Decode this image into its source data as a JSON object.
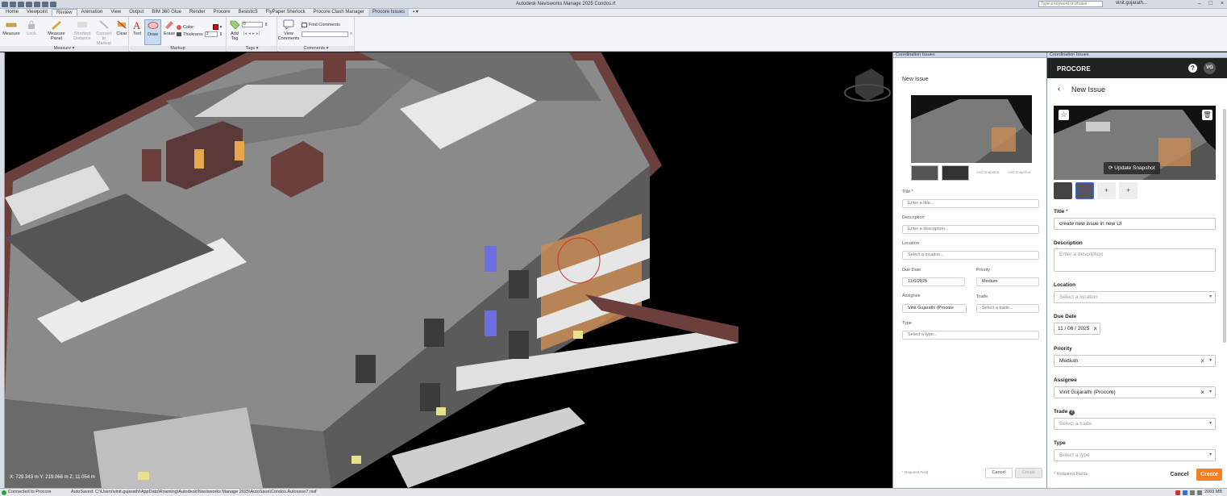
{
  "window": {
    "title": "Autodesk Navisworks Manage 2025    Condos.rt",
    "search_placeholder": "Type a keyword or phrase",
    "user": "vinit.gujarath..."
  },
  "tabs": [
    "Home",
    "Viewpoint",
    "Review",
    "Animation",
    "View",
    "Output",
    "BIM 360 Glue",
    "Render",
    "Procore",
    "Besistic5",
    "FlyPaper Sherlock",
    "Procore Clash Manager",
    "Procore Issues"
  ],
  "active_tab": "Review",
  "ribbon": {
    "measure_group": "Measure",
    "markup_group": "Markup",
    "tags_group": "Tags",
    "comments_group": "Comments",
    "buttons": {
      "measure": "Measure",
      "lock": "Lock",
      "measure_panel": "Measure Panel",
      "shortest_distance": "Shortest Distance",
      "convert_to_markup": "Convert to Markup",
      "clear": "Clear",
      "text": "Text",
      "draw": "Draw",
      "erase": "Erase",
      "color": "Color:",
      "thickness": "Thickness",
      "thickness_value": "3",
      "add_tag": "Add Tag",
      "tag_value": "0",
      "view_comments": "View Comments",
      "find_comments": "Find Comments"
    }
  },
  "viewport": {
    "coords": "X: 729.343 m  Y: 219.068 m  Z: 11.054 m"
  },
  "coordination": {
    "header": "Coordination Issues",
    "title": "New Issue",
    "add_snapshot": "Add Snapshot",
    "title_label": "Title *",
    "title_placeholder": "Enter a title...",
    "description_label": "Description",
    "description_placeholder": "Enter a description...",
    "location_label": "Location",
    "location_placeholder": "Select a location...",
    "due_date_label": "Due Date",
    "due_date_value": "11/6/2025",
    "priority_label": "Priority",
    "priority_value": "Medium",
    "assignee_label": "Assignee",
    "assignee_value": "Vinit Gujarathi (Procore",
    "trade_label": "Trade",
    "trade_placeholder": "Select a trade...",
    "type_label": "Type",
    "type_placeholder": "Select a type...",
    "required_note": "* Required Field",
    "cancel": "Cancel",
    "create": "Create"
  },
  "procore": {
    "header": "Coordination Issues",
    "logo": "PROCORE",
    "avatar": "VG",
    "help": "?",
    "title": "New Issue",
    "update_snapshot": "Update Snapshot",
    "title_label": "Title",
    "title_value": "create new issue in new UI",
    "description_label": "Description",
    "description_placeholder": "Enter a description",
    "location_label": "Location",
    "location_placeholder": "Select a location",
    "due_date_label": "Due Date",
    "due_date_value": "11 / 06 / 2025",
    "priority_label": "Priority",
    "priority_value": "Medium",
    "assignee_label": "Assignee",
    "assignee_value": "Vinit Gujarathi (Procore)",
    "trade_label": "Trade",
    "trade_placeholder": "Select a trade",
    "type_label": "Type",
    "type_placeholder": "Select a type",
    "required_note": "* Required Fields",
    "cancel": "Cancel",
    "create": "Create",
    "accent": "#f47e20"
  },
  "statusbar": {
    "connection": "Connected to Procore",
    "autosave": "AutoSaved: C:\\Users\\vinit.gujarathi\\AppData\\Roaming\\Autodesk\\Navisworks Manage 2025\\AutoSave\\Condos.Autosave7.nwf",
    "memory": "2069 MB"
  }
}
